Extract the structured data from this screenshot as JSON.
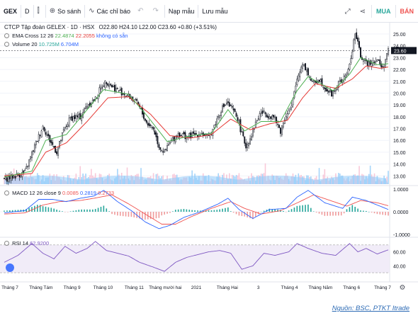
{
  "toolbar": {
    "symbol": "GEX",
    "interval": "D",
    "compare_label": "So sánh",
    "indicators_label": "Các chỉ báo",
    "templates_label": "Nạp mẫu",
    "save_label": "Lưu mẫu",
    "buy_label": "MUA",
    "sell_label": "BÁN"
  },
  "header": {
    "title": "CTCP Tập đoàn GELEX · 1D · HSX",
    "o": "O22.80",
    "h": "H24.10",
    "l": "L22.00",
    "c": "C23.60",
    "change": "+0.80 (+3.51%)"
  },
  "legend": {
    "ema_label": "EMA Cross 12 26",
    "ema_fast": "22.4874",
    "ema_slow": "22.2055",
    "ema_na": "không có sẵn",
    "volume_label": "Volume 20",
    "volume_v1": "10.725M",
    "volume_v2": "6.704M",
    "macd_label": "MACD 12 26 close 9",
    "macd_v1": "0.0085",
    "macd_v2": "0.2819",
    "macd_v3": "0.2733",
    "rsi_label": "RSI 14",
    "rsi_value": "62.9200"
  },
  "price_tag": "23.60",
  "settings_icon": "gear-icon",
  "source": "Nguồn: BSC, PTKT Itrade",
  "colors": {
    "up": "#26a69a",
    "down": "#ef5350",
    "candle": "#131722",
    "ema_fast": "#4caf50",
    "ema_slow": "#e53935",
    "macd": "#2962ff",
    "signal": "#ef5350",
    "rsi": "#7e57c2",
    "volume": "#90caf9"
  },
  "chart_data": [
    {
      "type": "candlestick",
      "title": "CTCP Tập đoàn GELEX · 1D · HSX",
      "x_ticks": [
        "Tháng 7",
        "Tháng Tám",
        "Tháng 9",
        "Tháng 10",
        "Tháng 11",
        "Tháng mười hai",
        "2021",
        "Tháng Hai",
        "3",
        "Tháng 4",
        "Tháng Năm",
        "Tháng 6",
        "Tháng 7"
      ],
      "y_ticks": [
        13.0,
        14.0,
        15.0,
        16.0,
        17.0,
        18.0,
        19.0,
        20.0,
        21.0,
        22.0,
        23.0,
        24.0,
        25.0
      ],
      "ylim": [
        12.3,
        25.6
      ],
      "close_path": [
        [
          0,
          12.7
        ],
        [
          8,
          13.0
        ],
        [
          15,
          13.3
        ],
        [
          22,
          15.5
        ],
        [
          28,
          17.2
        ],
        [
          33,
          16.0
        ],
        [
          38,
          15.0
        ],
        [
          43,
          16.8
        ],
        [
          48,
          17.9
        ],
        [
          55,
          18.0
        ],
        [
          60,
          19.0
        ],
        [
          66,
          19.5
        ],
        [
          70,
          20.5
        ],
        [
          74,
          21.0
        ],
        [
          80,
          20.4
        ],
        [
          86,
          20.0
        ],
        [
          92,
          19.6
        ],
        [
          97,
          19.0
        ],
        [
          103,
          17.5
        ],
        [
          108,
          17.0
        ],
        [
          112,
          15.5
        ],
        [
          116,
          15.0
        ],
        [
          120,
          15.8
        ],
        [
          126,
          16.6
        ],
        [
          132,
          16.3
        ],
        [
          138,
          16.5
        ],
        [
          143,
          16.6
        ],
        [
          148,
          16.2
        ],
        [
          153,
          17.5
        ],
        [
          157,
          18.6
        ],
        [
          161,
          19.2
        ],
        [
          165,
          18.6
        ],
        [
          169,
          17.9
        ],
        [
          172,
          16.5
        ],
        [
          175,
          15.5
        ],
        [
          178,
          16.2
        ],
        [
          182,
          17.5
        ],
        [
          186,
          18.4
        ],
        [
          190,
          18.2
        ],
        [
          195,
          18.0
        ],
        [
          200,
          16.8
        ],
        [
          204,
          18.2
        ],
        [
          208,
          18.8
        ],
        [
          212,
          21.2
        ],
        [
          216,
          22.6
        ],
        [
          219,
          21.9
        ],
        [
          223,
          20.8
        ],
        [
          228,
          21.2
        ],
        [
          232,
          20.5
        ],
        [
          237,
          19.9
        ],
        [
          242,
          20.8
        ],
        [
          246,
          21.2
        ],
        [
          250,
          22.3
        ],
        [
          254,
          25.1
        ],
        [
          258,
          23.2
        ],
        [
          262,
          22.5
        ],
        [
          266,
          22.7
        ],
        [
          270,
          22.8
        ],
        [
          274,
          22.1
        ],
        [
          278,
          23.6
        ]
      ],
      "ema_fast": [
        [
          0,
          12.9
        ],
        [
          20,
          13.4
        ],
        [
          30,
          16.0
        ],
        [
          45,
          16.5
        ],
        [
          60,
          18.6
        ],
        [
          72,
          20.3
        ],
        [
          90,
          19.9
        ],
        [
          104,
          18.0
        ],
        [
          118,
          15.9
        ],
        [
          135,
          16.4
        ],
        [
          150,
          16.6
        ],
        [
          162,
          18.6
        ],
        [
          174,
          16.8
        ],
        [
          186,
          17.6
        ],
        [
          200,
          17.6
        ],
        [
          212,
          20.2
        ],
        [
          220,
          21.4
        ],
        [
          238,
          20.2
        ],
        [
          250,
          21.6
        ],
        [
          258,
          23.0
        ],
        [
          270,
          22.4
        ],
        [
          278,
          22.49
        ]
      ],
      "ema_slow": [
        [
          0,
          13.0
        ],
        [
          20,
          13.2
        ],
        [
          30,
          15.0
        ],
        [
          45,
          15.8
        ],
        [
          60,
          17.6
        ],
        [
          75,
          19.6
        ],
        [
          90,
          19.7
        ],
        [
          106,
          18.2
        ],
        [
          120,
          16.4
        ],
        [
          135,
          16.2
        ],
        [
          150,
          16.5
        ],
        [
          164,
          17.8
        ],
        [
          178,
          16.9
        ],
        [
          192,
          17.4
        ],
        [
          205,
          17.7
        ],
        [
          216,
          19.6
        ],
        [
          225,
          20.8
        ],
        [
          240,
          20.4
        ],
        [
          252,
          21.2
        ],
        [
          262,
          22.3
        ],
        [
          272,
          22.1
        ],
        [
          278,
          22.21
        ]
      ]
    },
    {
      "type": "bar",
      "title": "Volume 20",
      "series": [
        {
          "name": "Volume 20",
          "values": [
            "10.725M",
            "6.704M"
          ]
        }
      ]
    },
    {
      "type": "line",
      "title": "MACD 12 26 close 9",
      "y_ticks": [
        1.0,
        0.0,
        -1.0
      ],
      "ylim": [
        -1.1,
        1.1
      ],
      "macd": [
        [
          0,
          -0.05
        ],
        [
          15,
          0.05
        ],
        [
          25,
          0.55
        ],
        [
          35,
          0.55
        ],
        [
          45,
          0.45
        ],
        [
          55,
          0.6
        ],
        [
          65,
          0.7
        ],
        [
          72,
          0.95
        ],
        [
          82,
          0.45
        ],
        [
          92,
          0.05
        ],
        [
          102,
          -0.45
        ],
        [
          112,
          -0.75
        ],
        [
          120,
          -0.6
        ],
        [
          130,
          -0.25
        ],
        [
          142,
          0.0
        ],
        [
          155,
          0.35
        ],
        [
          162,
          0.6
        ],
        [
          170,
          0.1
        ],
        [
          180,
          -0.3
        ],
        [
          192,
          0.1
        ],
        [
          204,
          0.15
        ],
        [
          212,
          0.65
        ],
        [
          220,
          0.95
        ],
        [
          232,
          0.4
        ],
        [
          245,
          0.15
        ],
        [
          252,
          0.65
        ],
        [
          262,
          0.5
        ],
        [
          270,
          0.3
        ],
        [
          278,
          0.1
        ]
      ],
      "signal": [
        [
          0,
          -0.1
        ],
        [
          15,
          -0.05
        ],
        [
          28,
          0.3
        ],
        [
          40,
          0.45
        ],
        [
          55,
          0.5
        ],
        [
          65,
          0.6
        ],
        [
          78,
          0.75
        ],
        [
          90,
          0.35
        ],
        [
          102,
          -0.1
        ],
        [
          114,
          -0.55
        ],
        [
          124,
          -0.55
        ],
        [
          136,
          -0.2
        ],
        [
          150,
          0.15
        ],
        [
          164,
          0.45
        ],
        [
          174,
          0.15
        ],
        [
          186,
          -0.1
        ],
        [
          200,
          0.05
        ],
        [
          214,
          0.45
        ],
        [
          224,
          0.75
        ],
        [
          236,
          0.5
        ],
        [
          248,
          0.25
        ],
        [
          258,
          0.5
        ],
        [
          270,
          0.4
        ],
        [
          278,
          0.27
        ]
      ],
      "histogram_last": [
        0.0085,
        0.2819,
        0.2733
      ]
    },
    {
      "type": "line",
      "title": "RSI 14",
      "y_ticks": [
        40.0,
        60.0
      ],
      "ylim": [
        25,
        80
      ],
      "band": [
        30,
        70
      ],
      "values": [
        [
          0,
          45
        ],
        [
          10,
          55
        ],
        [
          20,
          72
        ],
        [
          28,
          58
        ],
        [
          36,
          50
        ],
        [
          44,
          68
        ],
        [
          52,
          58
        ],
        [
          60,
          65
        ],
        [
          66,
          75
        ],
        [
          74,
          62
        ],
        [
          82,
          58
        ],
        [
          90,
          54
        ],
        [
          98,
          45
        ],
        [
          108,
          38
        ],
        [
          116,
          32
        ],
        [
          124,
          45
        ],
        [
          132,
          52
        ],
        [
          140,
          56
        ],
        [
          148,
          60
        ],
        [
          156,
          62
        ],
        [
          164,
          58
        ],
        [
          172,
          35
        ],
        [
          180,
          40
        ],
        [
          188,
          58
        ],
        [
          196,
          55
        ],
        [
          206,
          60
        ],
        [
          212,
          72
        ],
        [
          220,
          65
        ],
        [
          230,
          58
        ],
        [
          240,
          55
        ],
        [
          250,
          72
        ],
        [
          256,
          60
        ],
        [
          262,
          65
        ],
        [
          270,
          57
        ],
        [
          278,
          62.92
        ]
      ]
    }
  ]
}
